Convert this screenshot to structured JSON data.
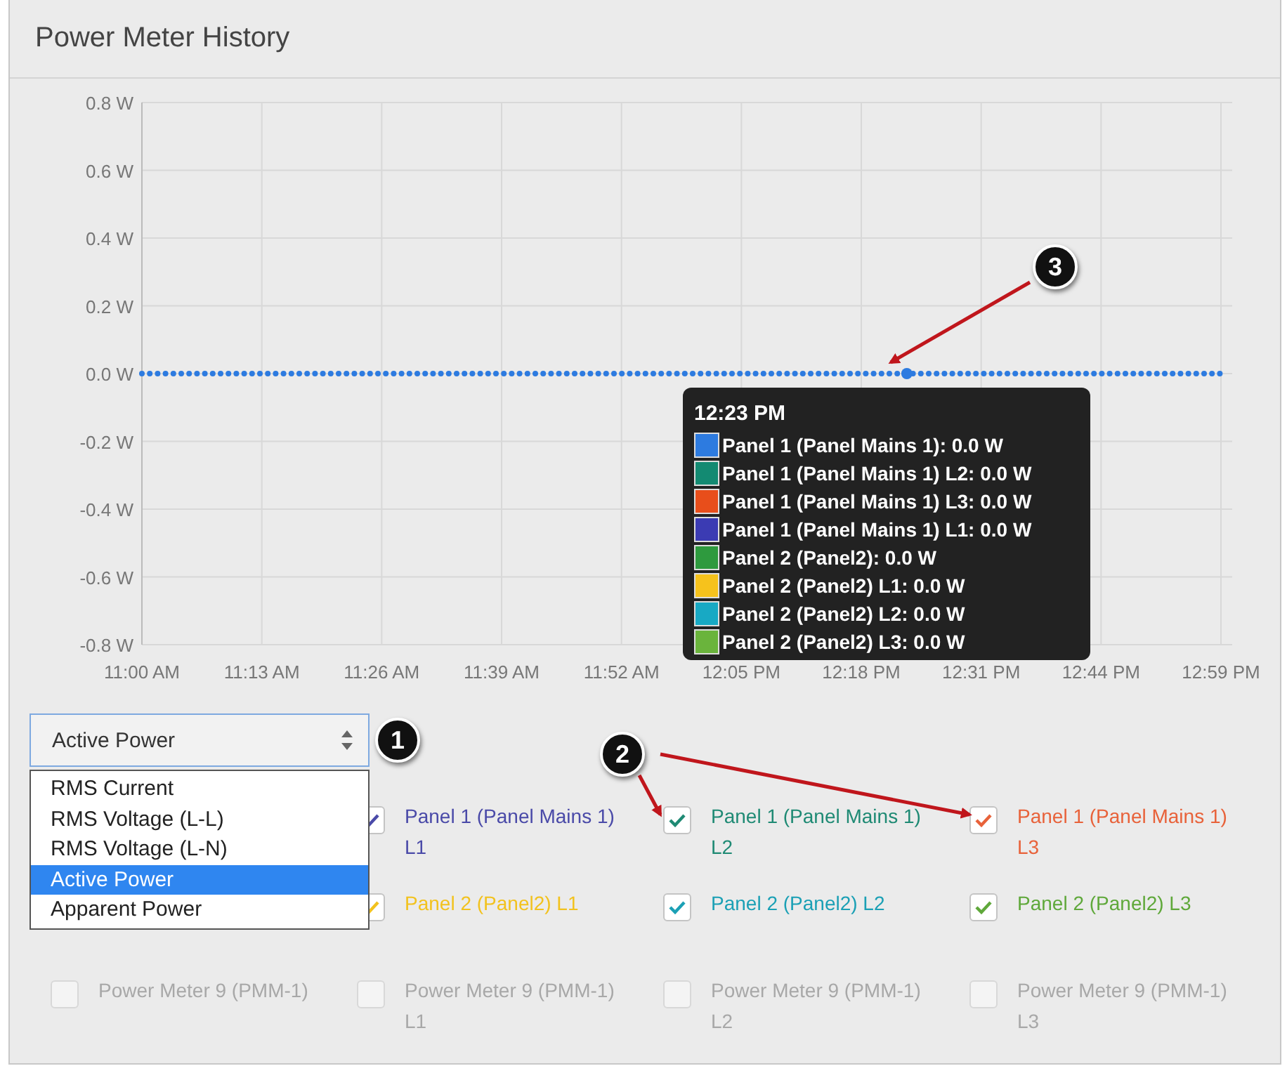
{
  "panel": {
    "title": "Power Meter History"
  },
  "chart": {
    "chart_data": {
      "type": "line",
      "categories": [
        "11:00 AM",
        "11:13 AM",
        "11:26 AM",
        "11:39 AM",
        "11:52 AM",
        "12:05 PM",
        "12:18 PM",
        "12:31 PM",
        "12:44 PM",
        "12:59 PM"
      ],
      "ylim": [
        -0.8,
        0.8
      ],
      "grid": true,
      "yticks": [
        {
          "value": 0.8,
          "label": "0.8 W"
        },
        {
          "value": 0.6,
          "label": "0.6 W"
        },
        {
          "value": 0.4,
          "label": "0.4 W"
        },
        {
          "value": 0.2,
          "label": "0.2 W"
        },
        {
          "value": 0,
          "label": "0.0 W"
        },
        {
          "value": -0.2,
          "label": "-0.2 W"
        },
        {
          "value": -0.4,
          "label": "-0.4 W"
        },
        {
          "value": -0.6,
          "label": "-0.6 W"
        },
        {
          "value": -0.8,
          "label": "-0.8 W"
        }
      ],
      "series": [
        {
          "color": "#2d7be0",
          "line_style": "dotted",
          "values": [
            0,
            0,
            0,
            0,
            0,
            0,
            0,
            0,
            0,
            0
          ]
        }
      ]
    },
    "tooltip": {
      "time": "12:23 PM",
      "entries": [
        {
          "text": "Panel 1 (Panel Mains 1): 0.0 W",
          "color": "#2d7be0"
        },
        {
          "text": "Panel 1 (Panel Mains 1) L2: 0.0 W",
          "color": "#138a72"
        },
        {
          "text": "Panel 1 (Panel Mains 1) L3: 0.0 W",
          "color": "#e84e1b"
        },
        {
          "text": "Panel 1 (Panel Mains 1) L1: 0.0 W",
          "color": "#3b3bb3"
        },
        {
          "text": "Panel 2 (Panel2): 0.0 W",
          "color": "#2e9a3e"
        },
        {
          "text": "Panel 2 (Panel2) L1: 0.0 W",
          "color": "#f6c21c"
        },
        {
          "text": "Panel 2 (Panel2) L2: 0.0 W",
          "color": "#18a9c4"
        },
        {
          "text": "Panel 2 (Panel2) L3: 0.0 W",
          "color": "#6ab43c"
        }
      ]
    }
  },
  "measure_select": {
    "value": "Active Power",
    "expanded": true,
    "options": [
      {
        "label": "RMS Current",
        "selected": false
      },
      {
        "label": "RMS Voltage (L-L)",
        "selected": false
      },
      {
        "label": "RMS Voltage (L-N)",
        "selected": false
      },
      {
        "label": "Active Power",
        "selected": true
      },
      {
        "label": "Apparent Power",
        "selected": false
      }
    ]
  },
  "series_toggles": [
    {
      "cells": [
        {
          "label": "Panel 1 (Panel Mains 1) L1",
          "checked": true,
          "color": "#4a4aa8"
        },
        {
          "label": "Panel 1 (Panel Mains 1) L2",
          "checked": true,
          "color": "#1f8a74"
        },
        {
          "label": "Panel 1 (Panel Mains 1) L3",
          "checked": true,
          "color": "#e8623a"
        }
      ]
    },
    {
      "cells": [
        {
          "label": "Panel 2 (Panel2) L1",
          "checked": true,
          "color": "#f2c21e"
        },
        {
          "label": "Panel 2 (Panel2) L2",
          "checked": true,
          "color": "#1ba0b5"
        },
        {
          "label": "Panel 2 (Panel2) L3",
          "checked": true,
          "color": "#5fa83a"
        }
      ]
    },
    {
      "cells": [
        {
          "label": "Power Meter 9 (PMM-1)",
          "checked": false,
          "color": "#a8a8a8"
        },
        {
          "label": "Power Meter 9 (PMM-1) L1",
          "checked": false,
          "color": "#a8a8a8"
        },
        {
          "label": "Power Meter 9 (PMM-1) L2",
          "checked": false,
          "color": "#a8a8a8"
        },
        {
          "label": "Power Meter 9 (PMM-1) L3",
          "checked": false,
          "color": "#a8a8a8"
        }
      ]
    }
  ],
  "callouts": [
    {
      "label": "1"
    },
    {
      "label": "2"
    },
    {
      "label": "3"
    }
  ]
}
